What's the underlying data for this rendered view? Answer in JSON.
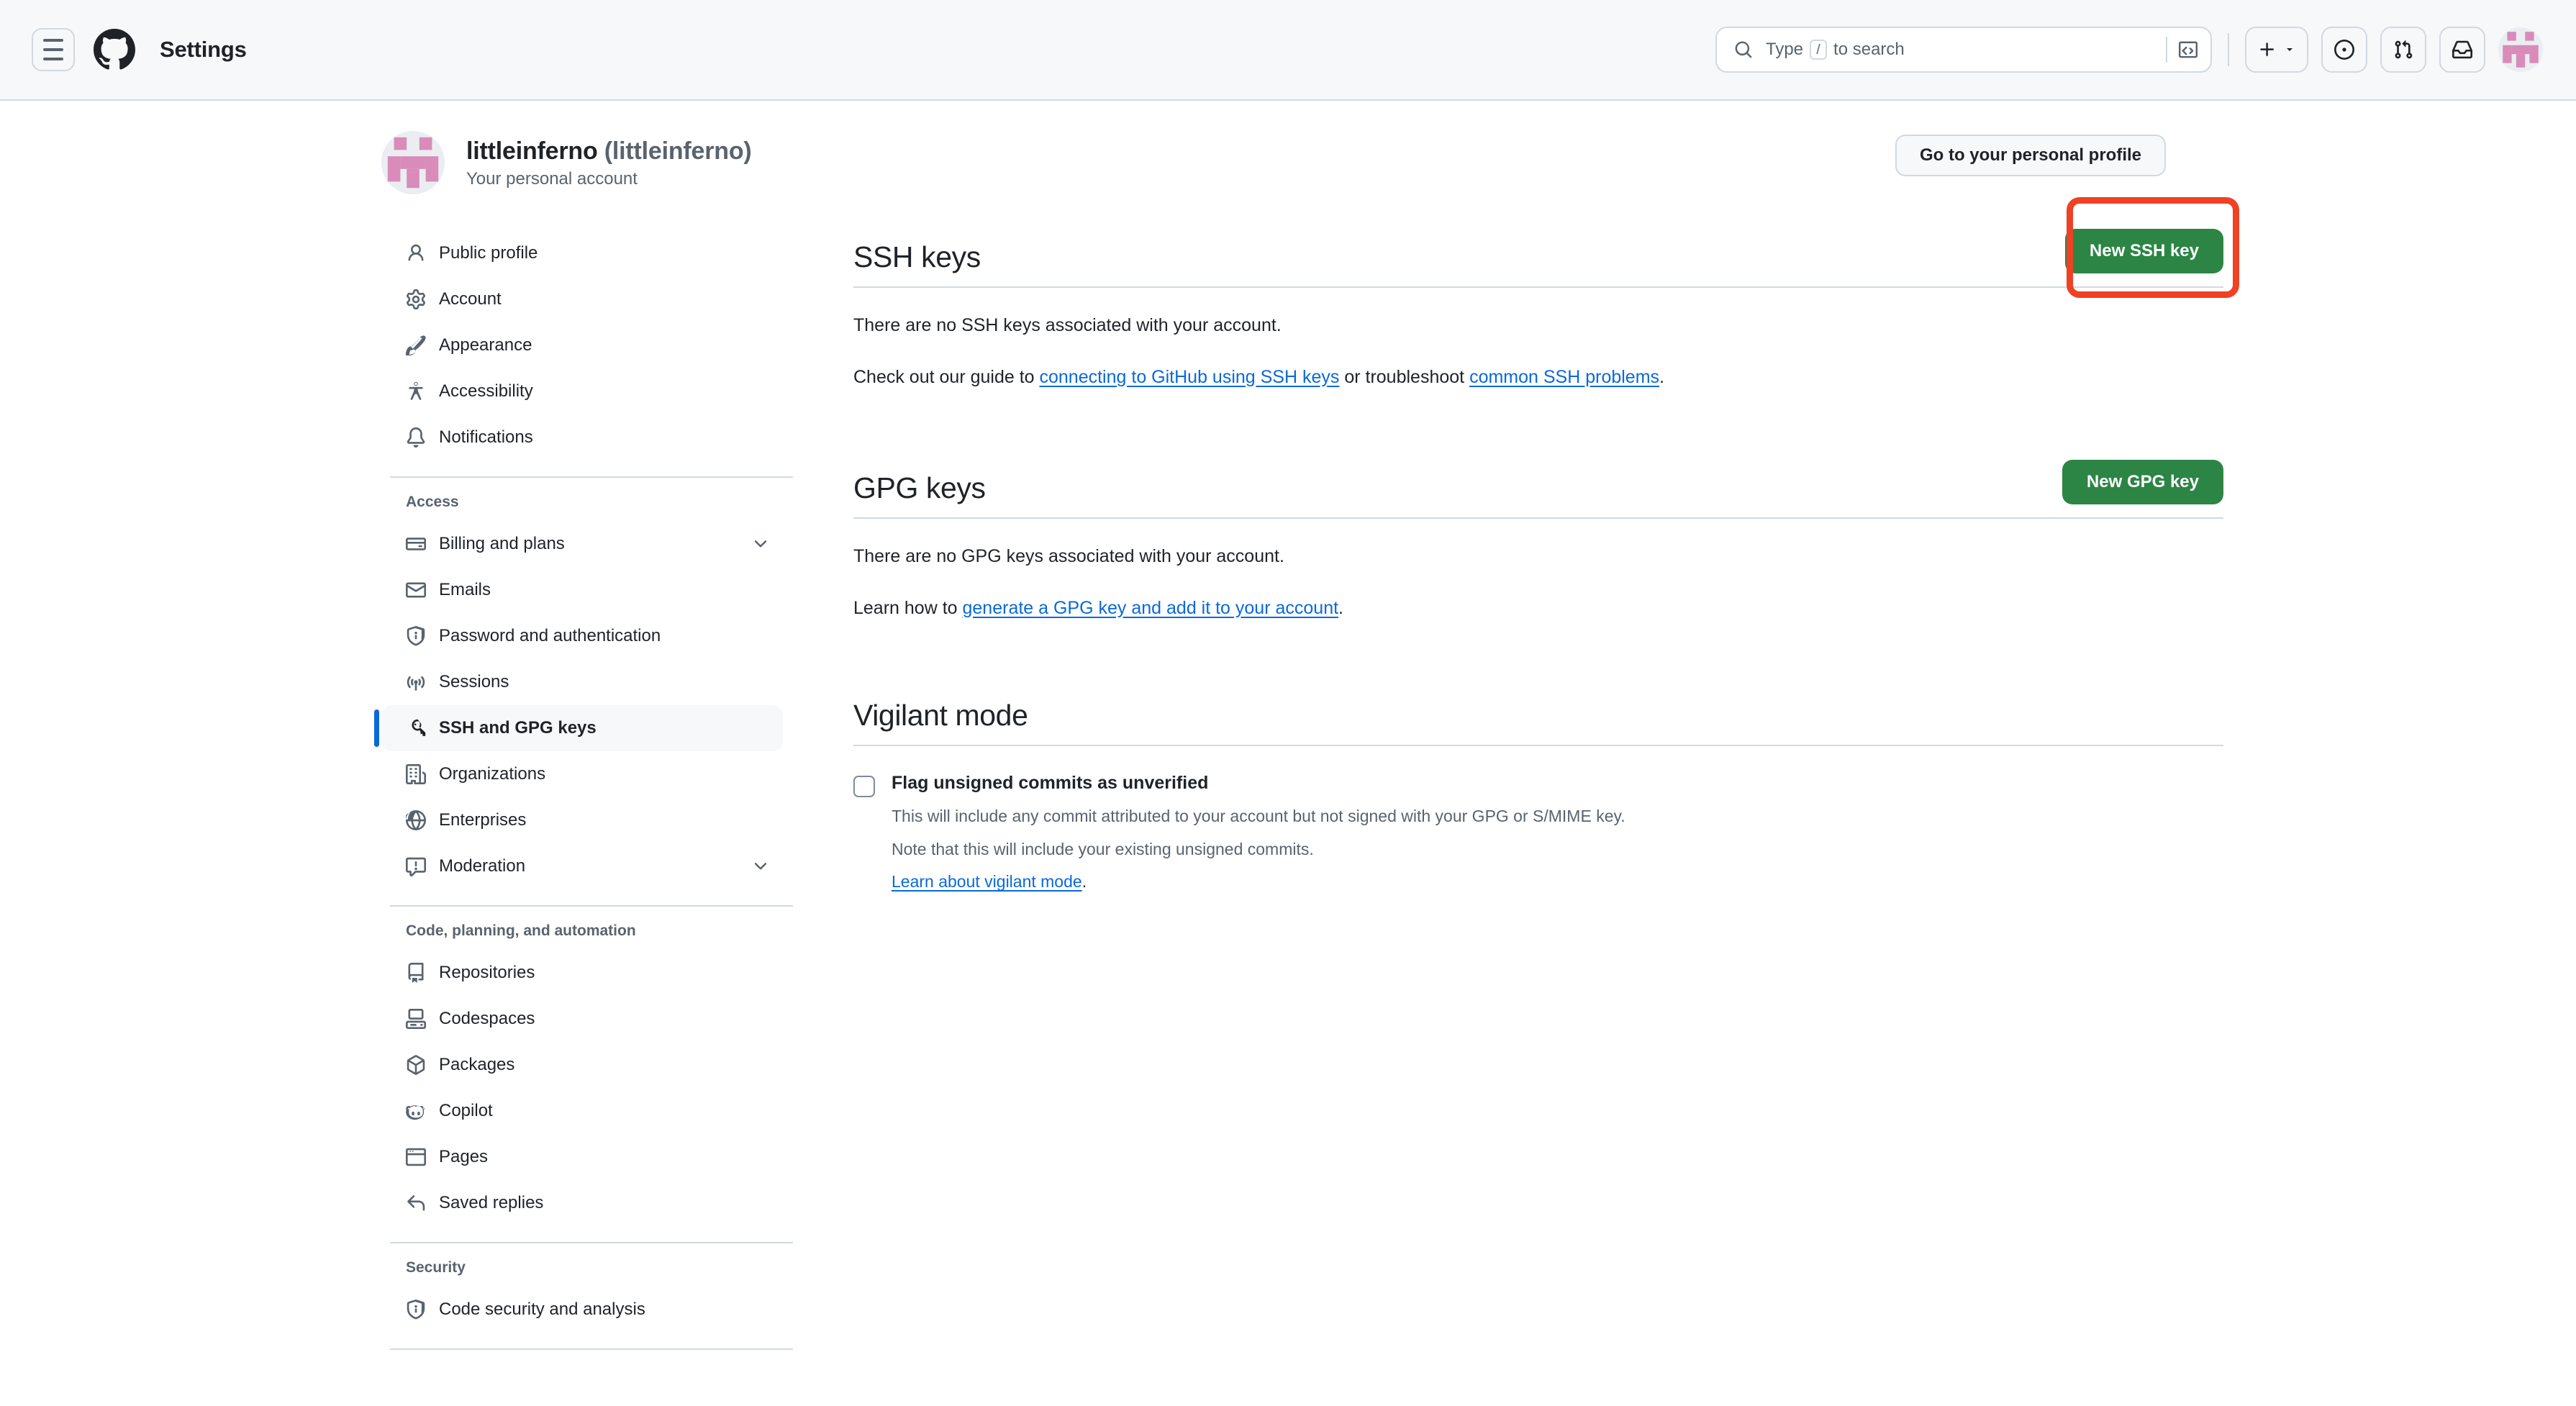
{
  "header": {
    "menu_label": "menu",
    "title": "Settings",
    "search": {
      "placeholder_pre": "Type",
      "slash_key": "/",
      "placeholder_post": "to search"
    },
    "icons": {
      "hamburger": "hamburger-icon",
      "github_logo": "github-logo-icon",
      "search": "search-icon",
      "terminal": "terminal-icon",
      "plus": "plus-icon",
      "chevron_down": "chevron-down-icon",
      "issues": "issues-icon",
      "pull_requests": "pull-request-icon",
      "inbox": "inbox-icon",
      "avatar": "avatar-icon"
    }
  },
  "profile": {
    "login": "littleinferno",
    "login_paren": "(littleinferno)",
    "subtitle": "Your personal account",
    "go_to_profile_label": "Go to your personal profile"
  },
  "sidebar": {
    "groups": [
      {
        "title": "",
        "items": [
          {
            "label": "Public profile",
            "icon": "person-icon",
            "selected": false,
            "chevron": false
          },
          {
            "label": "Account",
            "icon": "gear-icon",
            "selected": false,
            "chevron": false
          },
          {
            "label": "Appearance",
            "icon": "paintbrush-icon",
            "selected": false,
            "chevron": false
          },
          {
            "label": "Accessibility",
            "icon": "accessibility-icon",
            "selected": false,
            "chevron": false
          },
          {
            "label": "Notifications",
            "icon": "bell-icon",
            "selected": false,
            "chevron": false
          }
        ]
      },
      {
        "title": "Access",
        "items": [
          {
            "label": "Billing and plans",
            "icon": "credit-card-icon",
            "selected": false,
            "chevron": true
          },
          {
            "label": "Emails",
            "icon": "mail-icon",
            "selected": false,
            "chevron": false
          },
          {
            "label": "Password and authentication",
            "icon": "shield-lock-icon",
            "selected": false,
            "chevron": false
          },
          {
            "label": "Sessions",
            "icon": "broadcast-icon",
            "selected": false,
            "chevron": false
          },
          {
            "label": "SSH and GPG keys",
            "icon": "key-icon",
            "selected": true,
            "chevron": false
          },
          {
            "label": "Organizations",
            "icon": "organization-icon",
            "selected": false,
            "chevron": false
          },
          {
            "label": "Enterprises",
            "icon": "globe-icon",
            "selected": false,
            "chevron": false
          },
          {
            "label": "Moderation",
            "icon": "report-icon",
            "selected": false,
            "chevron": true
          }
        ]
      },
      {
        "title": "Code, planning, and automation",
        "items": [
          {
            "label": "Repositories",
            "icon": "repo-icon",
            "selected": false,
            "chevron": false
          },
          {
            "label": "Codespaces",
            "icon": "codespaces-icon",
            "selected": false,
            "chevron": false
          },
          {
            "label": "Packages",
            "icon": "package-icon",
            "selected": false,
            "chevron": false
          },
          {
            "label": "Copilot",
            "icon": "copilot-icon",
            "selected": false,
            "chevron": false
          },
          {
            "label": "Pages",
            "icon": "browser-icon",
            "selected": false,
            "chevron": false
          },
          {
            "label": "Saved replies",
            "icon": "reply-icon",
            "selected": false,
            "chevron": false
          }
        ]
      },
      {
        "title": "Security",
        "items": [
          {
            "label": "Code security and analysis",
            "icon": "shield-lock-icon",
            "selected": false,
            "chevron": false
          }
        ]
      }
    ]
  },
  "main": {
    "ssh": {
      "title": "SSH keys",
      "button_label": "New SSH key",
      "empty_text": "There are no SSH keys associated with your account.",
      "guide_prefix": "Check out our guide to ",
      "guide_link": "connecting to GitHub using SSH keys",
      "guide_middle": " or troubleshoot ",
      "guide_link2": "common SSH problems",
      "guide_suffix": "."
    },
    "gpg": {
      "title": "GPG keys",
      "button_label": "New GPG key",
      "empty_text": "There are no GPG keys associated with your account.",
      "learn_prefix": "Learn how to ",
      "learn_link": "generate a GPG key and add it to your account",
      "learn_suffix": "."
    },
    "vigilant": {
      "title": "Vigilant mode",
      "checkbox_label": "Flag unsigned commits as unverified",
      "checkbox_checked": false,
      "note_line1": "This will include any commit attributed to your account but not signed with your GPG or S/MIME key.",
      "note_line2": "Note that this will include your existing unsigned commits.",
      "link_text": "Learn about vigilant mode",
      "link_suffix": "."
    }
  },
  "colors": {
    "accent_blue": "#0969da",
    "green_button": "#2c8545",
    "highlight_red": "#ef4123",
    "header_bg": "#f6f8fa",
    "border": "#d1d9e0",
    "muted_text": "#59636e",
    "avatar_pink": "#d98bb9"
  }
}
